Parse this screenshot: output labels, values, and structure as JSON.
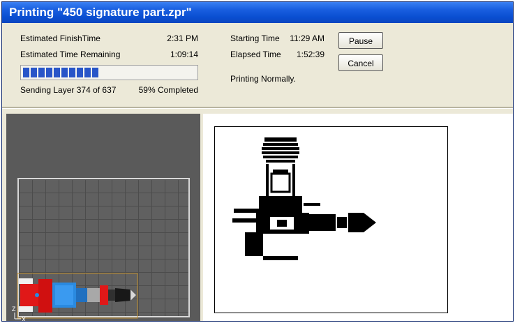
{
  "window": {
    "title": "Printing \"450 signature part.zpr\""
  },
  "status": {
    "est_finish_label": "Estimated FinishTime",
    "est_finish_value": "2:31 PM",
    "est_remaining_label": "Estimated Time Remaining",
    "est_remaining_value": "1:09:14",
    "layer_text": "Sending Layer 374 of 637",
    "percent_text": "59% Completed",
    "progress_fraction": 0.59,
    "start_label": "Starting Time",
    "start_value": "11:29 AM",
    "elapsed_label": "Elapsed Time",
    "elapsed_value": "1:52:39",
    "message": "Printing Normally."
  },
  "buttons": {
    "pause": "Pause",
    "cancel": "Cancel"
  },
  "viewport": {
    "axis_z": "Z",
    "axis_x": "X"
  },
  "colors": {
    "titlebar": "#0a4fd2",
    "progress": "#2855c8",
    "model_red": "#e01818",
    "model_blue": "#2a8ae0"
  }
}
